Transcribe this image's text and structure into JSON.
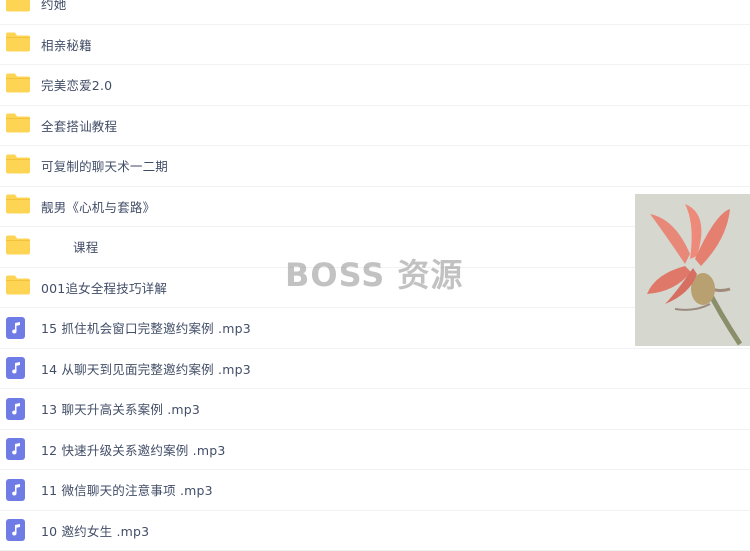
{
  "files": [
    {
      "type": "folder",
      "name": "约她"
    },
    {
      "type": "folder",
      "name": "相亲秘籍"
    },
    {
      "type": "folder",
      "name": "完美恋爱2.0"
    },
    {
      "type": "folder",
      "name": "全套搭讪教程"
    },
    {
      "type": "folder",
      "name": "可复制的聊天术一二期"
    },
    {
      "type": "folder",
      "name": "靓男《心机与套路》"
    },
    {
      "type": "folder",
      "name": "课程"
    },
    {
      "type": "folder",
      "name": "001追女全程技巧详解"
    },
    {
      "type": "audio",
      "name": "15 抓住机会窗口完整邀约案例 .mp3"
    },
    {
      "type": "audio",
      "name": "14 从聊天到见面完整邀约案例 .mp3"
    },
    {
      "type": "audio",
      "name": "13 聊天升高关系案例 .mp3"
    },
    {
      "type": "audio",
      "name": "12 快速升级关系邀约案例 .mp3"
    },
    {
      "type": "audio",
      "name": "11 微信聊天的注意事项 .mp3"
    },
    {
      "type": "audio",
      "name": "10 邀约女生 .mp3"
    }
  ],
  "watermark": "BOSS 资源",
  "colors": {
    "folder": "#fdd454",
    "folder_tab": "#f5c33b",
    "audio": "#6f7ce6"
  },
  "icons": {
    "folder": "folder-icon",
    "audio": "music-note-icon"
  }
}
